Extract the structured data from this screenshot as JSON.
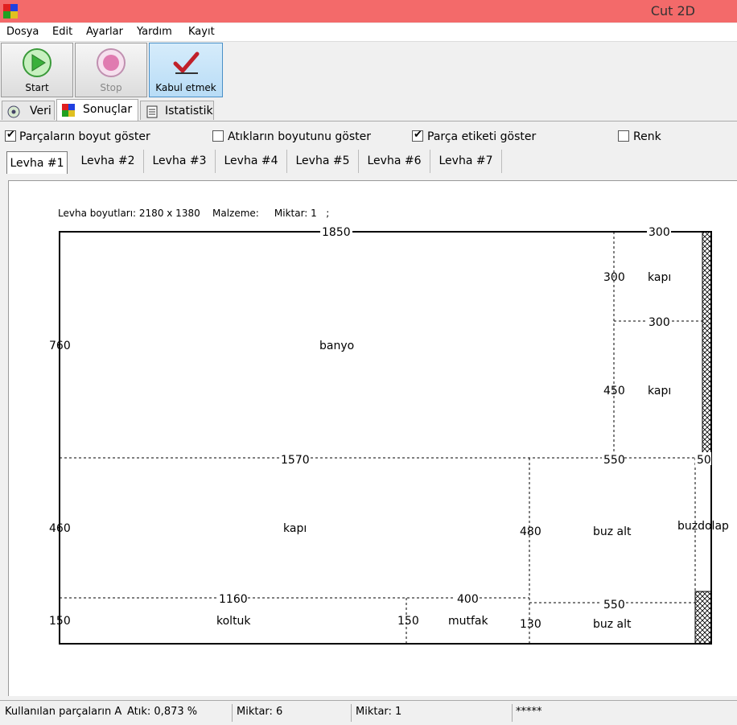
{
  "window": {
    "title": "Cut 2D"
  },
  "menu": [
    "Dosya",
    "Edit",
    "Ayarlar",
    "Yardım",
    "Kayıt"
  ],
  "toolbar": {
    "start": "Start",
    "stop": "Stop",
    "accept": "Kabul etmek"
  },
  "tabs": [
    "Veri",
    "Sonuçlar",
    "Istatistik"
  ],
  "options": [
    {
      "label": "Parçaların boyut göster",
      "checked": true
    },
    {
      "label": "Atıkların boyutunu göster",
      "checked": false
    },
    {
      "label": "Parça etiketi göster",
      "checked": true
    },
    {
      "label": "Renk",
      "checked": false
    }
  ],
  "sheet_tabs": [
    "Levha #1",
    "Levha #2",
    "Levha #3",
    "Levha #4",
    "Levha #5",
    "Levha #6",
    "Levha #7"
  ],
  "sheet_info": "Levha boyutları: 2180 x 1380    Malzeme:     Miktar: 1   ;",
  "drawing": {
    "labels": {
      "d1850": "1850",
      "d300a": "300",
      "d300b": "300",
      "d300c": "300",
      "d760": "760",
      "d450": "450",
      "d1570": "1570",
      "d550a": "550",
      "d50": "50",
      "d460": "460",
      "d480": "480",
      "d1160": "1160",
      "d400": "400",
      "d550b": "550",
      "d150a": "150",
      "d150b": "150",
      "d130": "130",
      "banyo": "banyo",
      "kapi1": "kapı",
      "kapi2": "kapı",
      "kapi3": "kapı",
      "buzalt1": "buz alt",
      "buzalt2": "buz alt",
      "buzdolap": "buzdolap",
      "koltuk": "koltuk",
      "mutfak": "mutfak"
    }
  },
  "status": {
    "used": "Kullanılan parçaların A",
    "waste": "Atık: 0,873 %",
    "qty1": "Miktar: 6",
    "qty2": "Miktar: 1",
    "stars": "*****"
  }
}
